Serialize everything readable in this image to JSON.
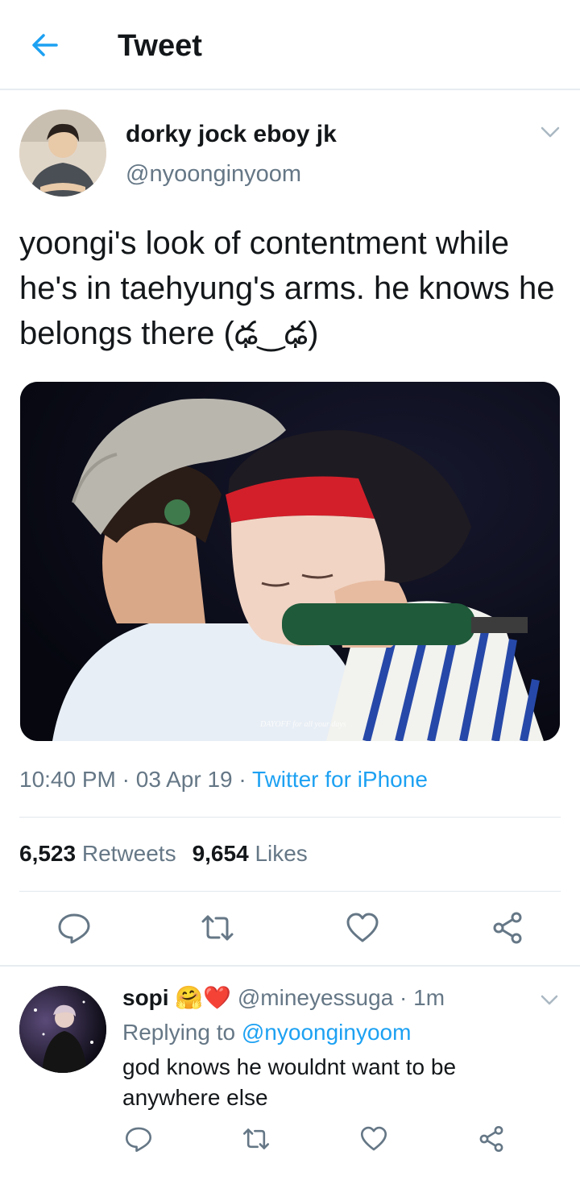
{
  "header": {
    "title": "Tweet",
    "back_icon": "arrow-left-icon"
  },
  "tweet": {
    "display_name": "dorky jock eboy jk",
    "handle": "@nyoonginyoom",
    "text": "yoongi's look of contentment while he's in taehyung's arms. he knows he belongs there (ఢ‿ఢ)",
    "media_watermark": "DAYOFF for all your days",
    "time": "10:40 PM",
    "date": "03 Apr 19",
    "source": "Twitter for iPhone",
    "retweets_count": "6,523",
    "retweets_label": "Retweets",
    "likes_count": "9,654",
    "likes_label": "Likes",
    "actions": [
      "reply-icon",
      "retweet-icon",
      "like-icon",
      "share-icon"
    ]
  },
  "reply": {
    "display_name": "sopi",
    "emojis": "🤗❤️",
    "handle": "@mineyessuga",
    "age": "1m",
    "replying_prefix": "Replying to",
    "replying_to": "@nyoonginyoom",
    "text": "god knows he wouldnt want to be anywhere else"
  },
  "colors": {
    "accent": "#1da1f2",
    "secondary_text": "#657786",
    "primary_text": "#14171a"
  }
}
